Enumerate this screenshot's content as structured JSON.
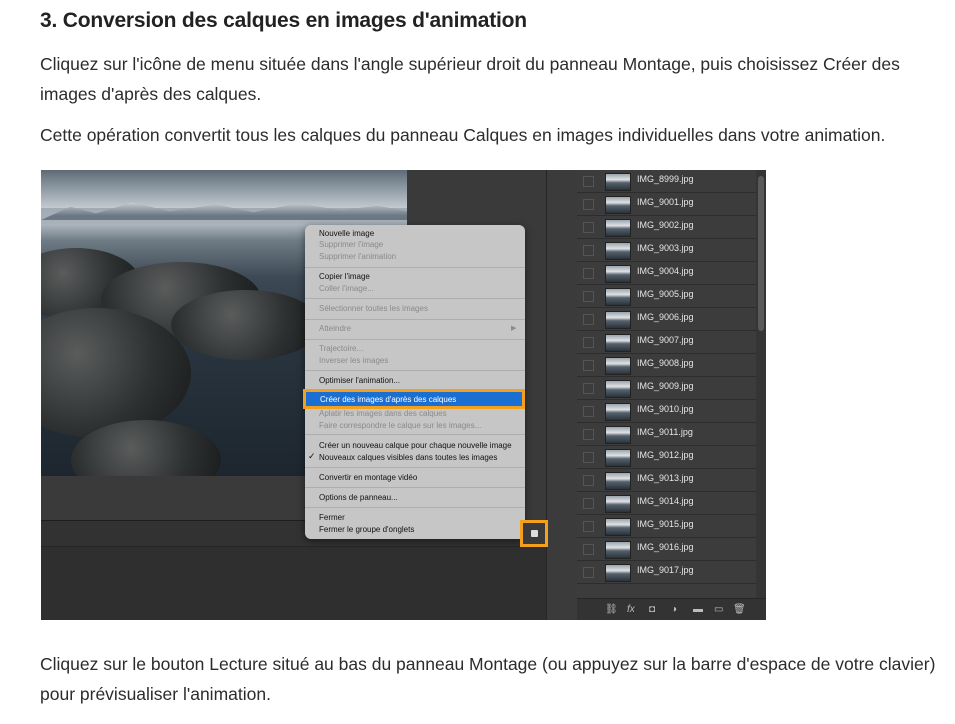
{
  "heading": "3. Conversion des calques en images d'animation",
  "paragraph1": "Cliquez sur l'icône de menu située dans l'angle supérieur droit du panneau Montage, puis choisissez Créer des images d'après des calques.",
  "paragraph2": "Cette opération convertit tous les calques du panneau Calques en images individuelles dans votre animation.",
  "paragraph3": "Cliquez sur le bouton Lecture situé au bas du panneau Montage (ou appuyez sur la barre d'espace de votre clavier) pour prévisualiser l'animation.",
  "menu": {
    "nouvelle": "Nouvelle image",
    "supprimer_image": "Supprimer l'image",
    "supprimer_animation": "Supprimer l'animation",
    "copier": "Copier l'image",
    "coller": "Coller l'image...",
    "selectionner": "Sélectionner toutes les images",
    "atteindre": "Atteindre",
    "trajectoire": "Trajectoire...",
    "inverser": "Inverser les images",
    "optimiser": "Optimiser l'animation...",
    "creer": "Créer des images d'après des calques",
    "aplatir": "Aplatir les images dans des calques",
    "faire": "Faire correspondre le calque sur les images...",
    "creer_calque": "Créer un nouveau calque pour chaque nouvelle image",
    "nouveaux_calques": "Nouveaux calques visibles dans toutes les images",
    "convertir": "Convertir en montage vidéo",
    "options": "Options de panneau...",
    "fermer": "Fermer",
    "fermer_groupe": "Fermer le groupe d'onglets",
    "check_glyph": "✓",
    "arrow_glyph": "▶"
  },
  "layers": [
    "IMG_8999.jpg",
    "IMG_9001.jpg",
    "IMG_9002.jpg",
    "IMG_9003.jpg",
    "IMG_9004.jpg",
    "IMG_9005.jpg",
    "IMG_9006.jpg",
    "IMG_9007.jpg",
    "IMG_9008.jpg",
    "IMG_9009.jpg",
    "IMG_9010.jpg",
    "IMG_9011.jpg",
    "IMG_9012.jpg",
    "IMG_9013.jpg",
    "IMG_9014.jpg",
    "IMG_9015.jpg",
    "IMG_9016.jpg",
    "IMG_9017.jpg"
  ],
  "footer_icons": {
    "link": "⛓",
    "fx": "fx",
    "mask": "◘",
    "adjust": "◑",
    "folder": "▬",
    "new": "▭",
    "trash": "🗑"
  },
  "colors": {
    "highlight": "#f2a01d",
    "selection": "#1b6fd3"
  }
}
